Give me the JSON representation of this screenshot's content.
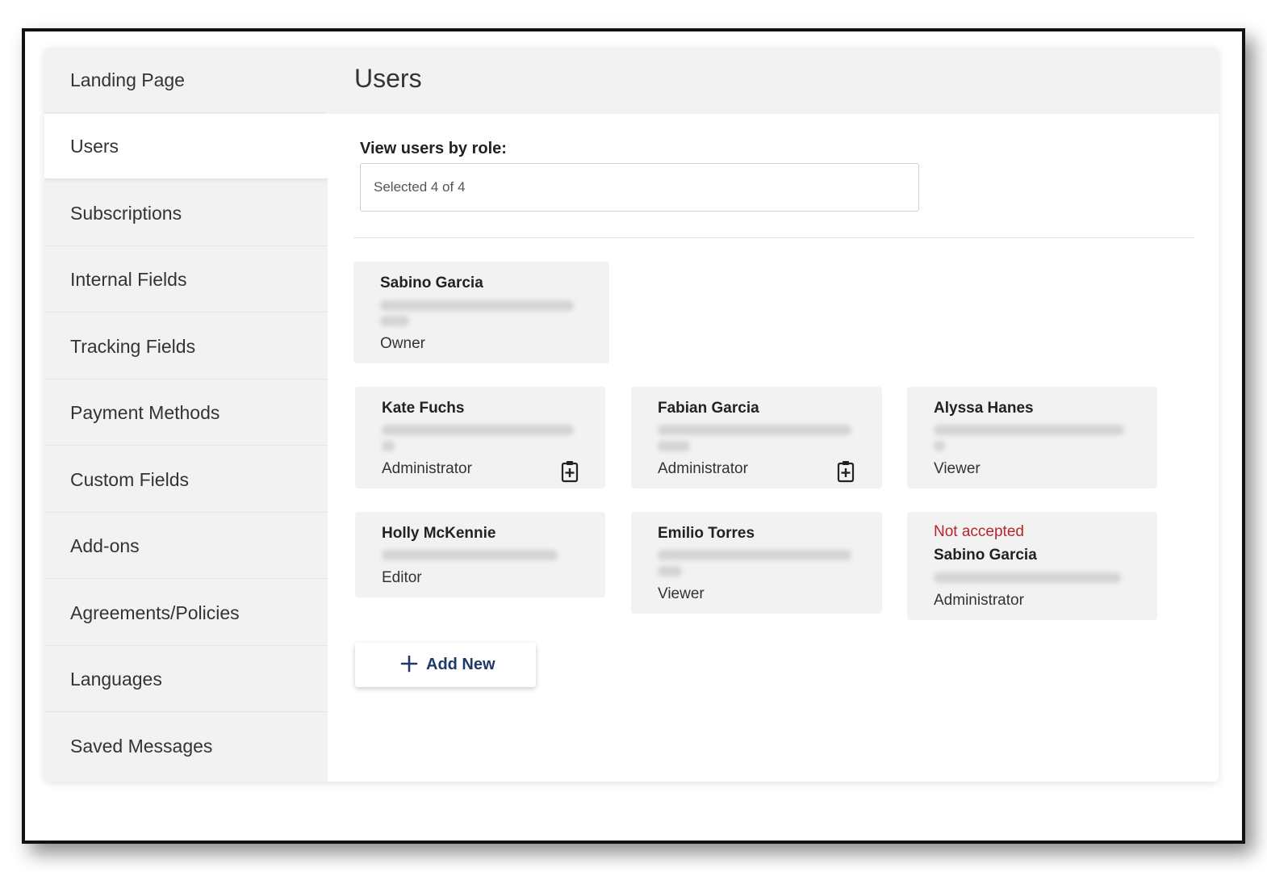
{
  "sidebar": {
    "items": [
      {
        "label": "Landing Page"
      },
      {
        "label": "Users"
      },
      {
        "label": "Subscriptions"
      },
      {
        "label": "Internal Fields"
      },
      {
        "label": "Tracking Fields"
      },
      {
        "label": "Payment Methods"
      },
      {
        "label": "Custom Fields"
      },
      {
        "label": "Add-ons"
      },
      {
        "label": "Agreements/Policies"
      },
      {
        "label": "Languages"
      },
      {
        "label": "Saved Messages"
      }
    ],
    "active": "Users"
  },
  "main": {
    "title": "Users",
    "filter": {
      "label": "View users by role:",
      "value": "Selected 4 of 4"
    },
    "owner": {
      "name": "Sabino Garcia",
      "role": "Owner"
    },
    "users": [
      {
        "name": "Kate Fuchs",
        "role": "Administrator",
        "icon": "clipboard-plus-icon"
      },
      {
        "name": "Fabian Garcia",
        "role": "Administrator",
        "icon": "clipboard-plus-icon"
      },
      {
        "name": "Alyssa Hanes",
        "role": "Viewer"
      },
      {
        "name": "Holly McKennie",
        "role": "Editor"
      },
      {
        "name": "Emilio Torres",
        "role": "Viewer"
      },
      {
        "status": "Not accepted",
        "name": "Sabino Garcia",
        "role": "Administrator"
      }
    ],
    "add_button": {
      "label": "Add New",
      "icon": "plus-icon"
    }
  },
  "colors": {
    "status_pending": "#b5262d",
    "button_text": "#1f3a68",
    "panel_gray": "#f2f2f2"
  }
}
